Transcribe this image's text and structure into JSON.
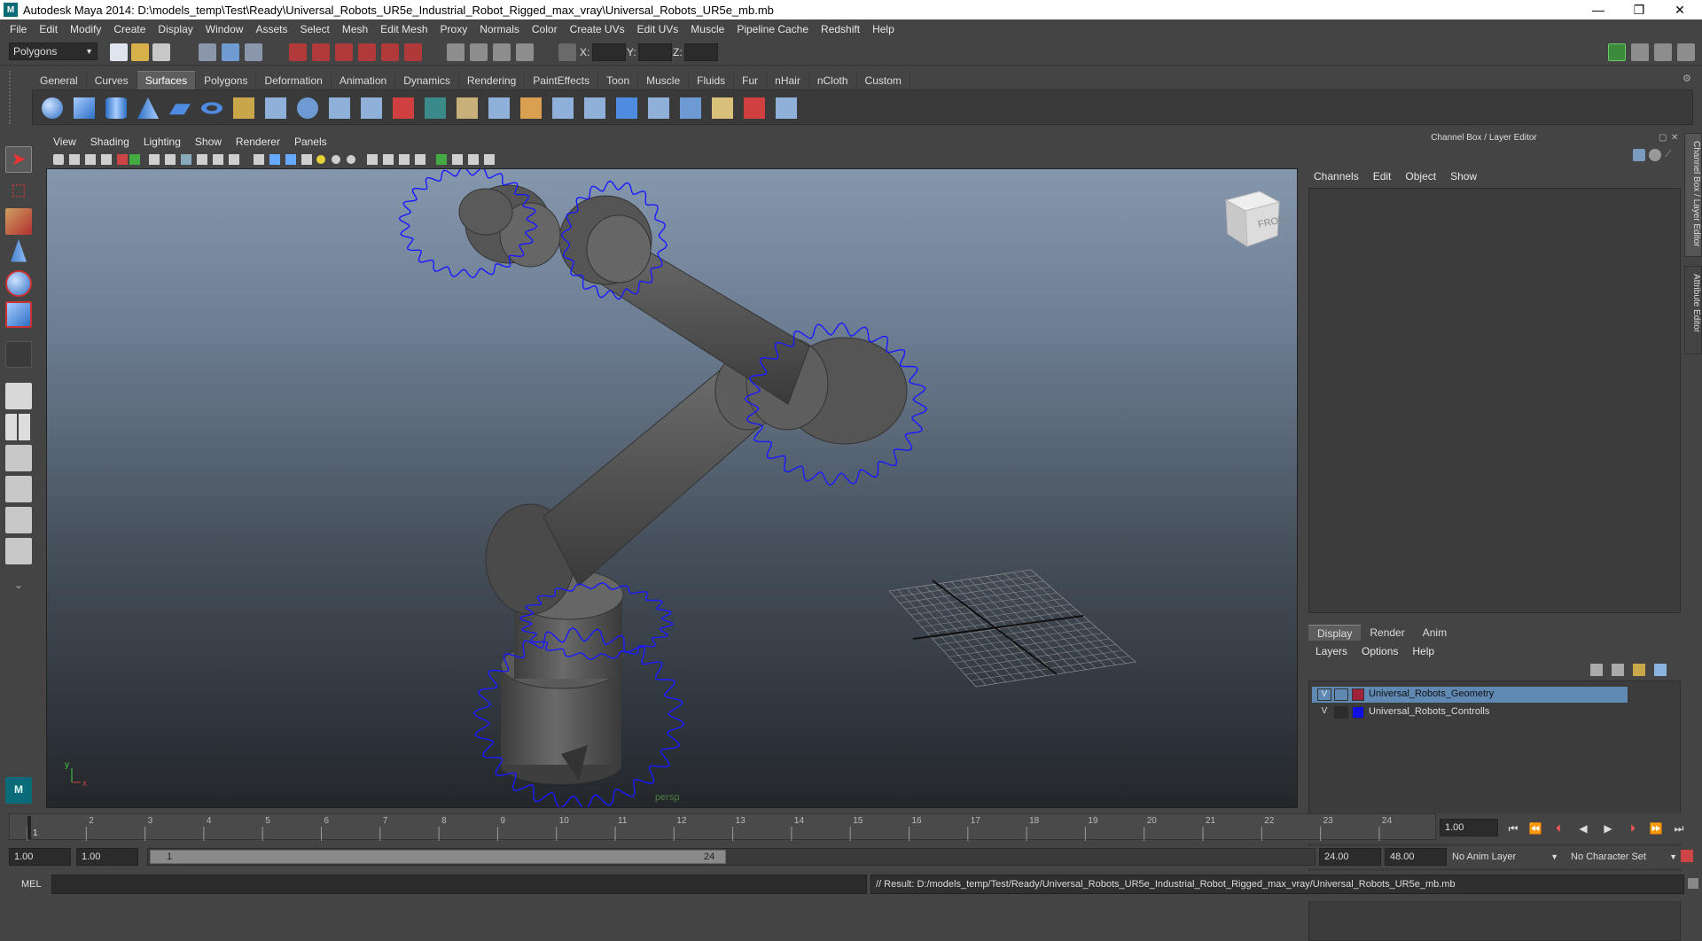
{
  "title_bar": {
    "app_title": "Autodesk Maya 2014: D:\\models_temp\\Test\\Ready\\Universal_Robots_UR5e_Industrial_Robot_Rigged_max_vray\\Universal_Robots_UR5e_mb.mb",
    "minimize": "—",
    "restore": "❐",
    "close": "✕"
  },
  "menubar": [
    "File",
    "Edit",
    "Modify",
    "Create",
    "Display",
    "Window",
    "Assets",
    "Select",
    "Mesh",
    "Edit Mesh",
    "Proxy",
    "Normals",
    "Color",
    "Create UVs",
    "Edit UVs",
    "Muscle",
    "Pipeline Cache",
    "Redshift",
    "Help"
  ],
  "status_line": {
    "mode": "Polygons",
    "x_label": "X:",
    "y_label": "Y:",
    "z_label": "Z:"
  },
  "shelf": {
    "tabs": [
      "General",
      "Curves",
      "Surfaces",
      "Polygons",
      "Deformation",
      "Animation",
      "Dynamics",
      "Rendering",
      "PaintEffects",
      "Toon",
      "Muscle",
      "Fluids",
      "Fur",
      "nHair",
      "nCloth",
      "Custom"
    ],
    "active_tab": "Surfaces"
  },
  "viewport": {
    "menu": [
      "View",
      "Shading",
      "Lighting",
      "Show",
      "Renderer",
      "Panels"
    ],
    "camera_label": "persp",
    "viewcube_label": "FRONT",
    "axis_x": "x",
    "axis_y": "y"
  },
  "channel_box": {
    "title": "Channel Box / Layer Editor",
    "menu": [
      "Channels",
      "Edit",
      "Object",
      "Show"
    ],
    "side_tab_1": "Channel Box / Layer Editor",
    "side_tab_2": "Attribute Editor"
  },
  "layer_editor": {
    "tabs": [
      "Display",
      "Render",
      "Anim"
    ],
    "active_tab": "Display",
    "menu": [
      "Layers",
      "Options",
      "Help"
    ],
    "layers": [
      {
        "visible": "V",
        "name": "Universal_Robots_Geometry",
        "color": "#a0213a",
        "selected": true
      },
      {
        "visible": "V",
        "name": "Universal_Robots_Controlls",
        "color": "#1010e0",
        "selected": false
      }
    ]
  },
  "timeline": {
    "ticks": [
      "1",
      "2",
      "3",
      "4",
      "5",
      "6",
      "7",
      "8",
      "9",
      "10",
      "11",
      "12",
      "13",
      "14",
      "15",
      "16",
      "17",
      "18",
      "19",
      "20",
      "21",
      "22",
      "23",
      "24"
    ],
    "current_frame": "1",
    "current_time_field": "1.00"
  },
  "range": {
    "start_time": "1.00",
    "playback_start": "1.00",
    "slider_start": "1",
    "slider_end": "24",
    "playback_end": "24.00",
    "end_time": "48.00",
    "anim_layer": "No Anim Layer",
    "character_set": "No Character Set"
  },
  "command_line": {
    "label": "MEL",
    "result": "// Result: D:/models_temp/Test/Ready/Universal_Robots_UR5e_Industrial_Robot_Rigged_max_vray/Universal_Robots_UR5e_mb.mb"
  },
  "colors": {
    "ui_bg": "#444444",
    "selected_row": "#5f88b3",
    "control_curve": "#1a1aff"
  }
}
